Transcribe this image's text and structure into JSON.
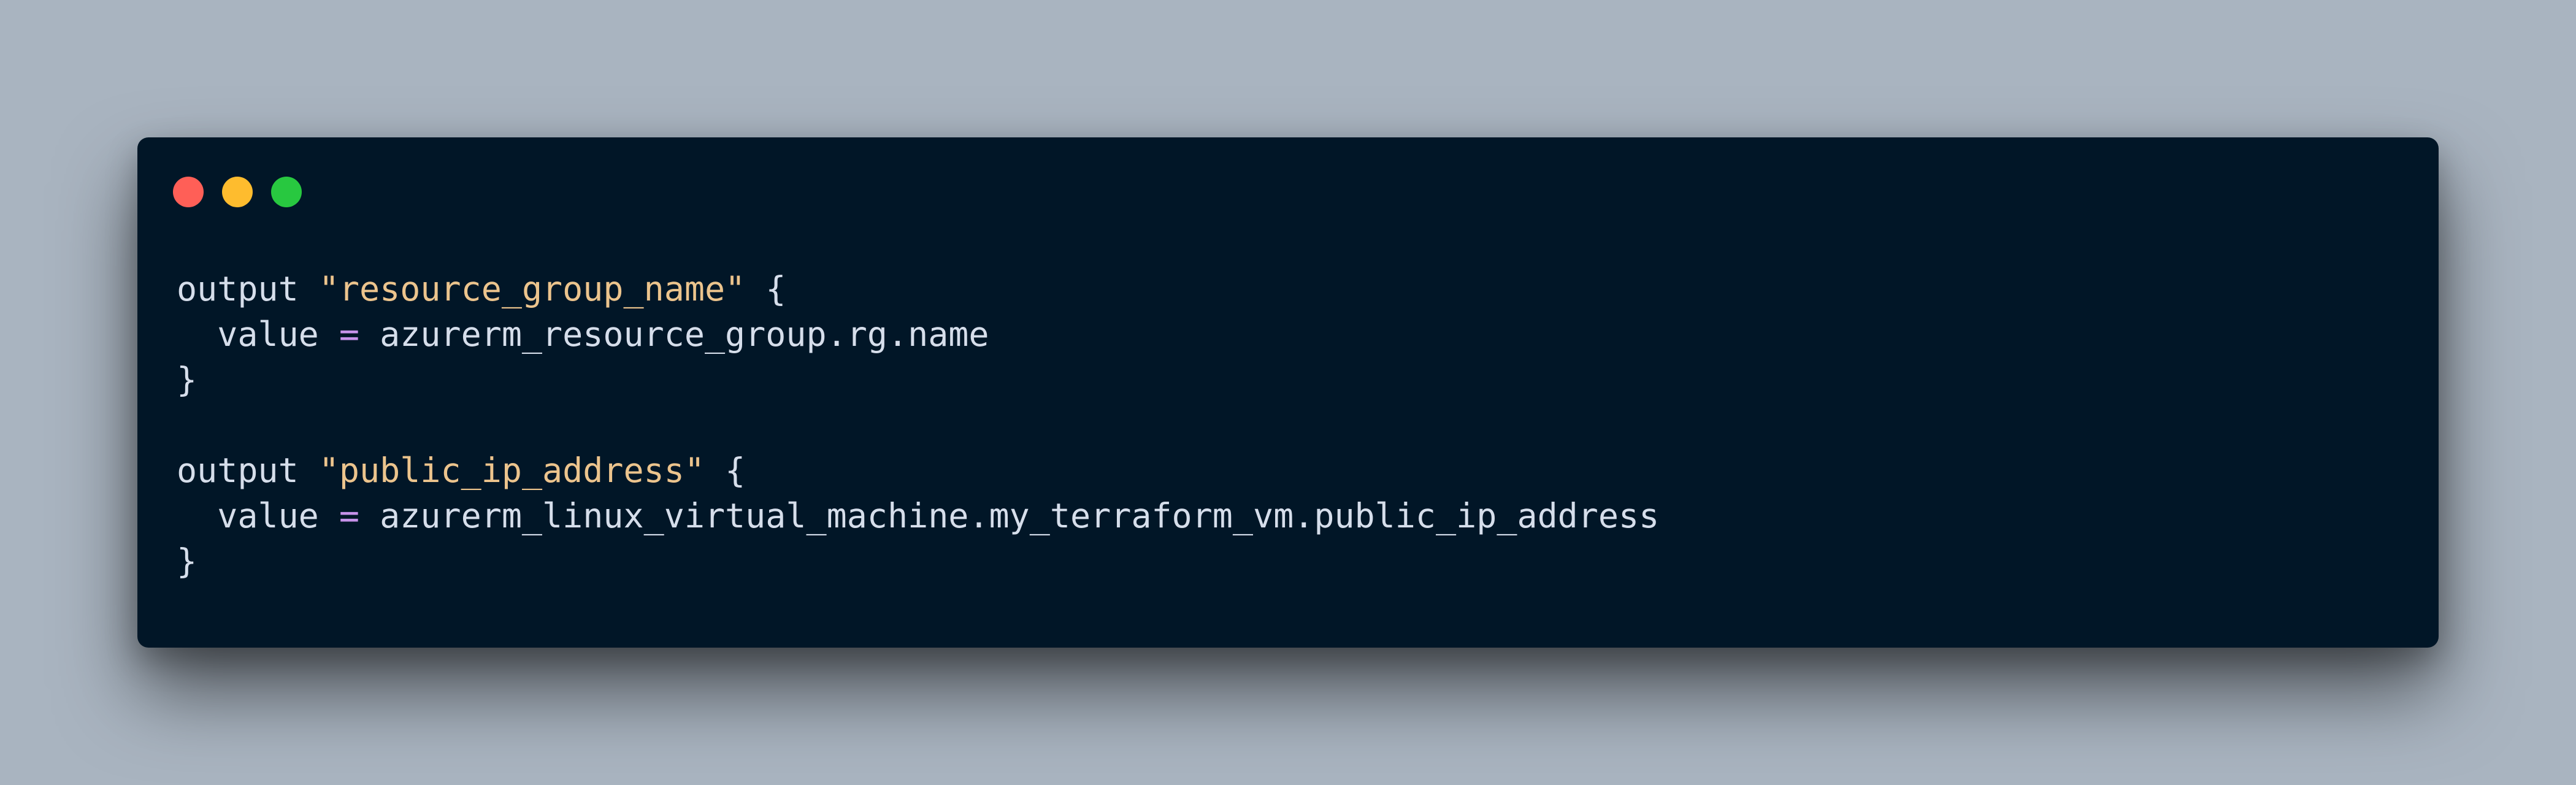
{
  "window": {
    "buttons": [
      {
        "name": "close",
        "color": "#ff5f57"
      },
      {
        "name": "minimize",
        "color": "#febc2e"
      },
      {
        "name": "maximize",
        "color": "#28c840"
      }
    ]
  },
  "theme": {
    "background": "#011627",
    "page_background": "#a9b4c0",
    "keyword": "#d6deeb",
    "string": "#ecc48d",
    "operator": "#c792ea",
    "text": "#d6deeb",
    "punct": "#d6deeb"
  },
  "code": {
    "lines": [
      [
        {
          "t": "keyword",
          "v": "output"
        },
        {
          "t": "text",
          "v": " "
        },
        {
          "t": "string",
          "v": "\"resource_group_name\""
        },
        {
          "t": "text",
          "v": " "
        },
        {
          "t": "punct",
          "v": "{"
        }
      ],
      [
        {
          "t": "text",
          "v": "  value "
        },
        {
          "t": "operator",
          "v": "="
        },
        {
          "t": "text",
          "v": " azurerm_resource_group.rg.name"
        }
      ],
      [
        {
          "t": "punct",
          "v": "}"
        }
      ],
      [],
      [
        {
          "t": "keyword",
          "v": "output"
        },
        {
          "t": "text",
          "v": " "
        },
        {
          "t": "string",
          "v": "\"public_ip_address\""
        },
        {
          "t": "text",
          "v": " "
        },
        {
          "t": "punct",
          "v": "{"
        }
      ],
      [
        {
          "t": "text",
          "v": "  value "
        },
        {
          "t": "operator",
          "v": "="
        },
        {
          "t": "text",
          "v": " azurerm_linux_virtual_machine.my_terraform_vm.public_ip_address"
        }
      ],
      [
        {
          "t": "punct",
          "v": "}"
        }
      ]
    ]
  }
}
